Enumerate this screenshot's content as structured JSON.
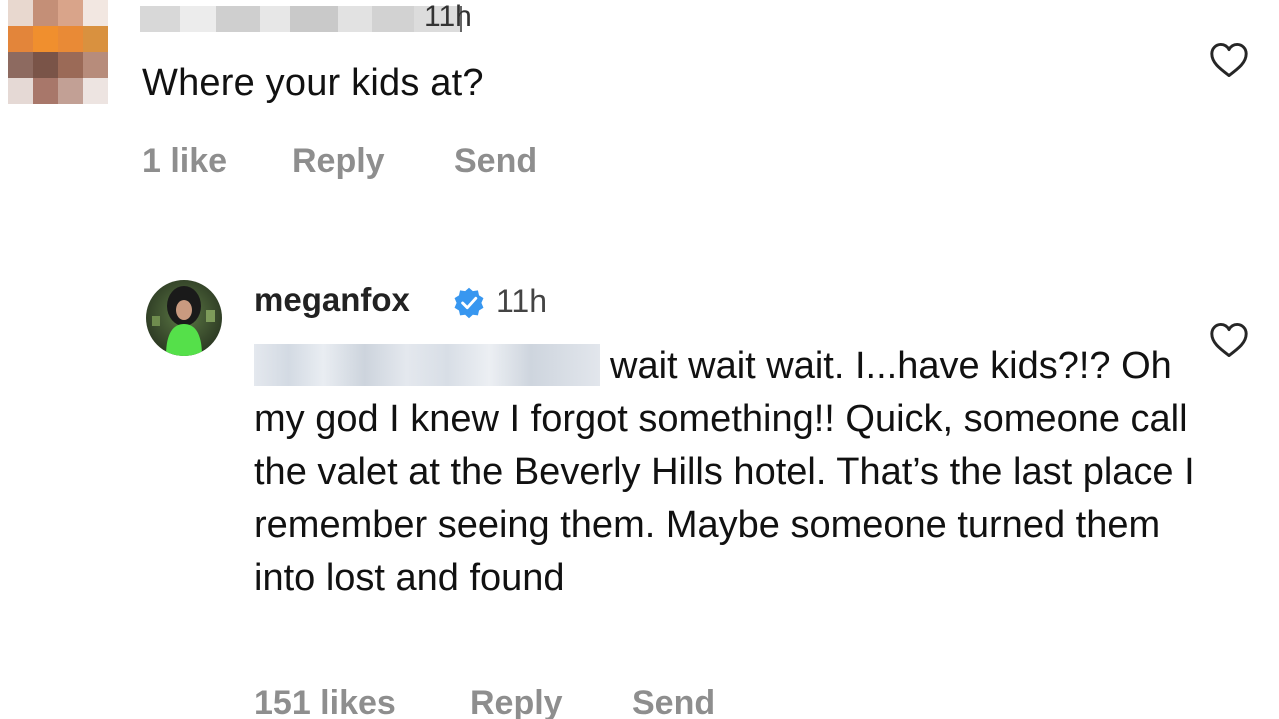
{
  "comment": {
    "time": "11h",
    "text": "Where your kids at?",
    "likes": "1 like",
    "reply_label": "Reply",
    "send_label": "Send"
  },
  "reply": {
    "username": "meganfox",
    "verified": true,
    "time": "11h",
    "text": "wait wait wait. I...have kids?!? Oh my god I knew I forgot something!! Quick, someone call the valet at the Beverly Hills hotel. That’s the last place I remember seeing them. Maybe someone turned them into lost and found",
    "likes": "151 likes",
    "reply_label": "Reply",
    "send_label": "Send"
  },
  "icons": {
    "like": "heart-outline-icon",
    "verified": "verified-badge-icon"
  },
  "colors": {
    "verified_blue": "#3897f0",
    "meta_gray": "#8e8e8e"
  }
}
